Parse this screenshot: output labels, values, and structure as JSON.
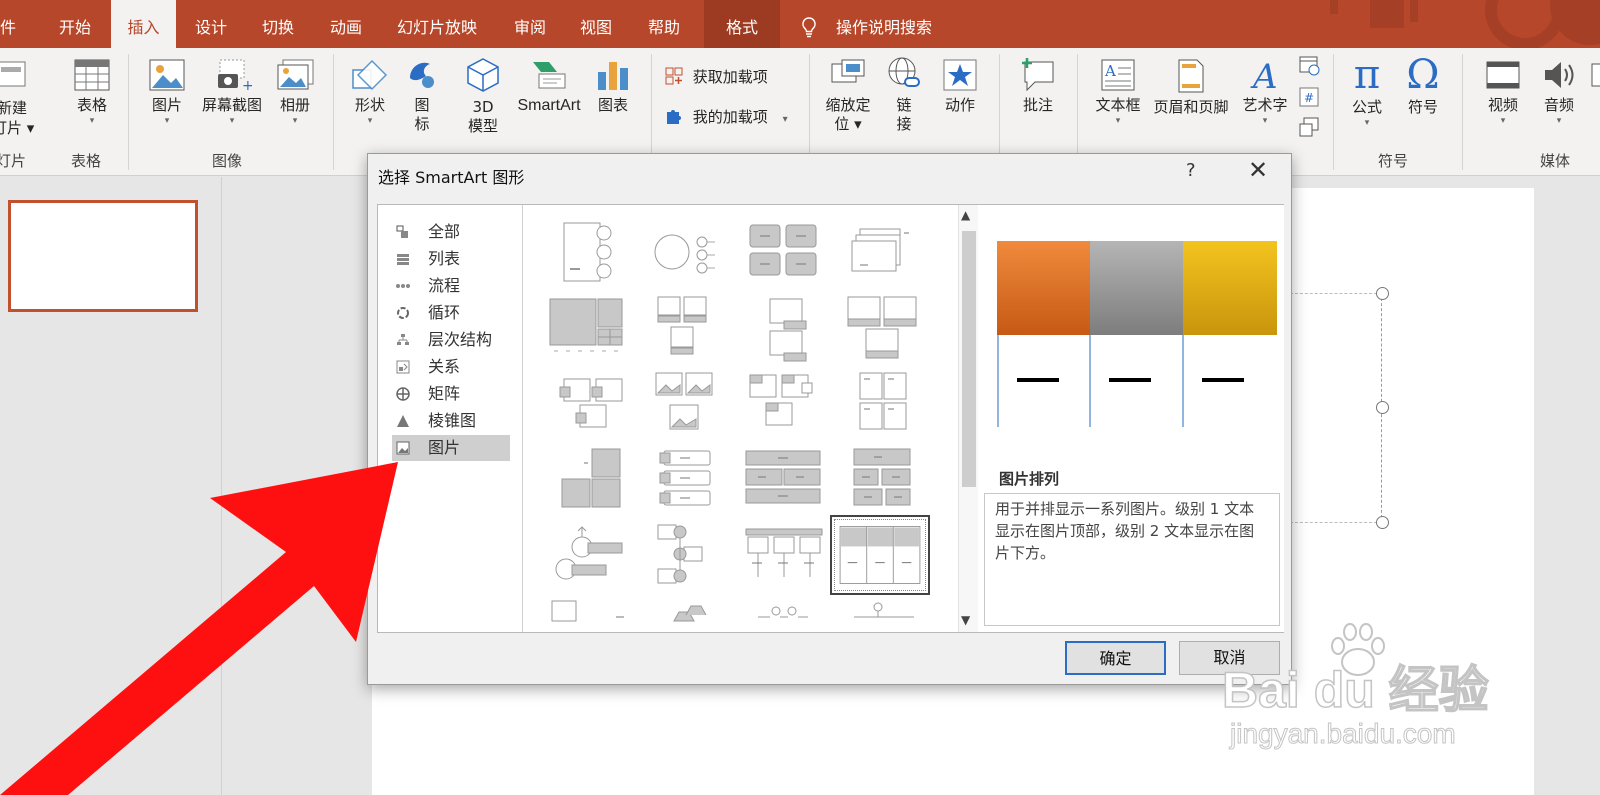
{
  "tabs": [
    "件",
    "开始",
    "插入",
    "设计",
    "切换",
    "动画",
    "幻灯片放映",
    "审阅",
    "视图",
    "帮助",
    "格式",
    "操作说明搜索"
  ],
  "ribbon": {
    "new_slide": [
      "新建",
      "灯片"
    ],
    "table": "表格",
    "picture": "图片",
    "screenshot": "屏幕截图",
    "album": "相册",
    "shapes": "形状",
    "icons": [
      "图",
      "标"
    ],
    "model3d": [
      "3D",
      "模型"
    ],
    "smartart": "SmartArt",
    "chart": "图表",
    "get_addins": "获取加载项",
    "my_addins": "我的加载项",
    "zoom": [
      "缩放定",
      "位"
    ],
    "link": [
      "链",
      "接"
    ],
    "action": "动作",
    "comment": "批注",
    "textbox": "文本框",
    "header_footer": "页眉和页脚",
    "wordart": "艺术字",
    "equation": "公式",
    "symbol": "符号",
    "video": "视频",
    "audio": "音频"
  },
  "groups": {
    "slides": "灯片",
    "tables": "表格",
    "images": "图像",
    "symbols": "符号",
    "media": "媒体"
  },
  "dialog": {
    "title": "选择 SmartArt 图形",
    "help": "?",
    "close": "✕",
    "categories": [
      "全部",
      "列表",
      "流程",
      "循环",
      "层次结构",
      "关系",
      "矩阵",
      "棱锥图",
      "图片"
    ],
    "selected_category": "图片",
    "preview_name": "图片排列",
    "preview_desc": "用于并排显示一系列图片。级别 1 文本显示在图片顶部，级别 2 文本显示在图片下方。",
    "ok": "确定",
    "cancel": "取消"
  },
  "watermark": {
    "line1": "Bai du 经验",
    "line2": "jingyan.baidu.com"
  },
  "colors": {
    "accent": "#b7472a",
    "preview1": "#e8782e",
    "preview2": "#9e9e9e",
    "preview3": "#e8b31a",
    "arrow": "#ff0000"
  }
}
